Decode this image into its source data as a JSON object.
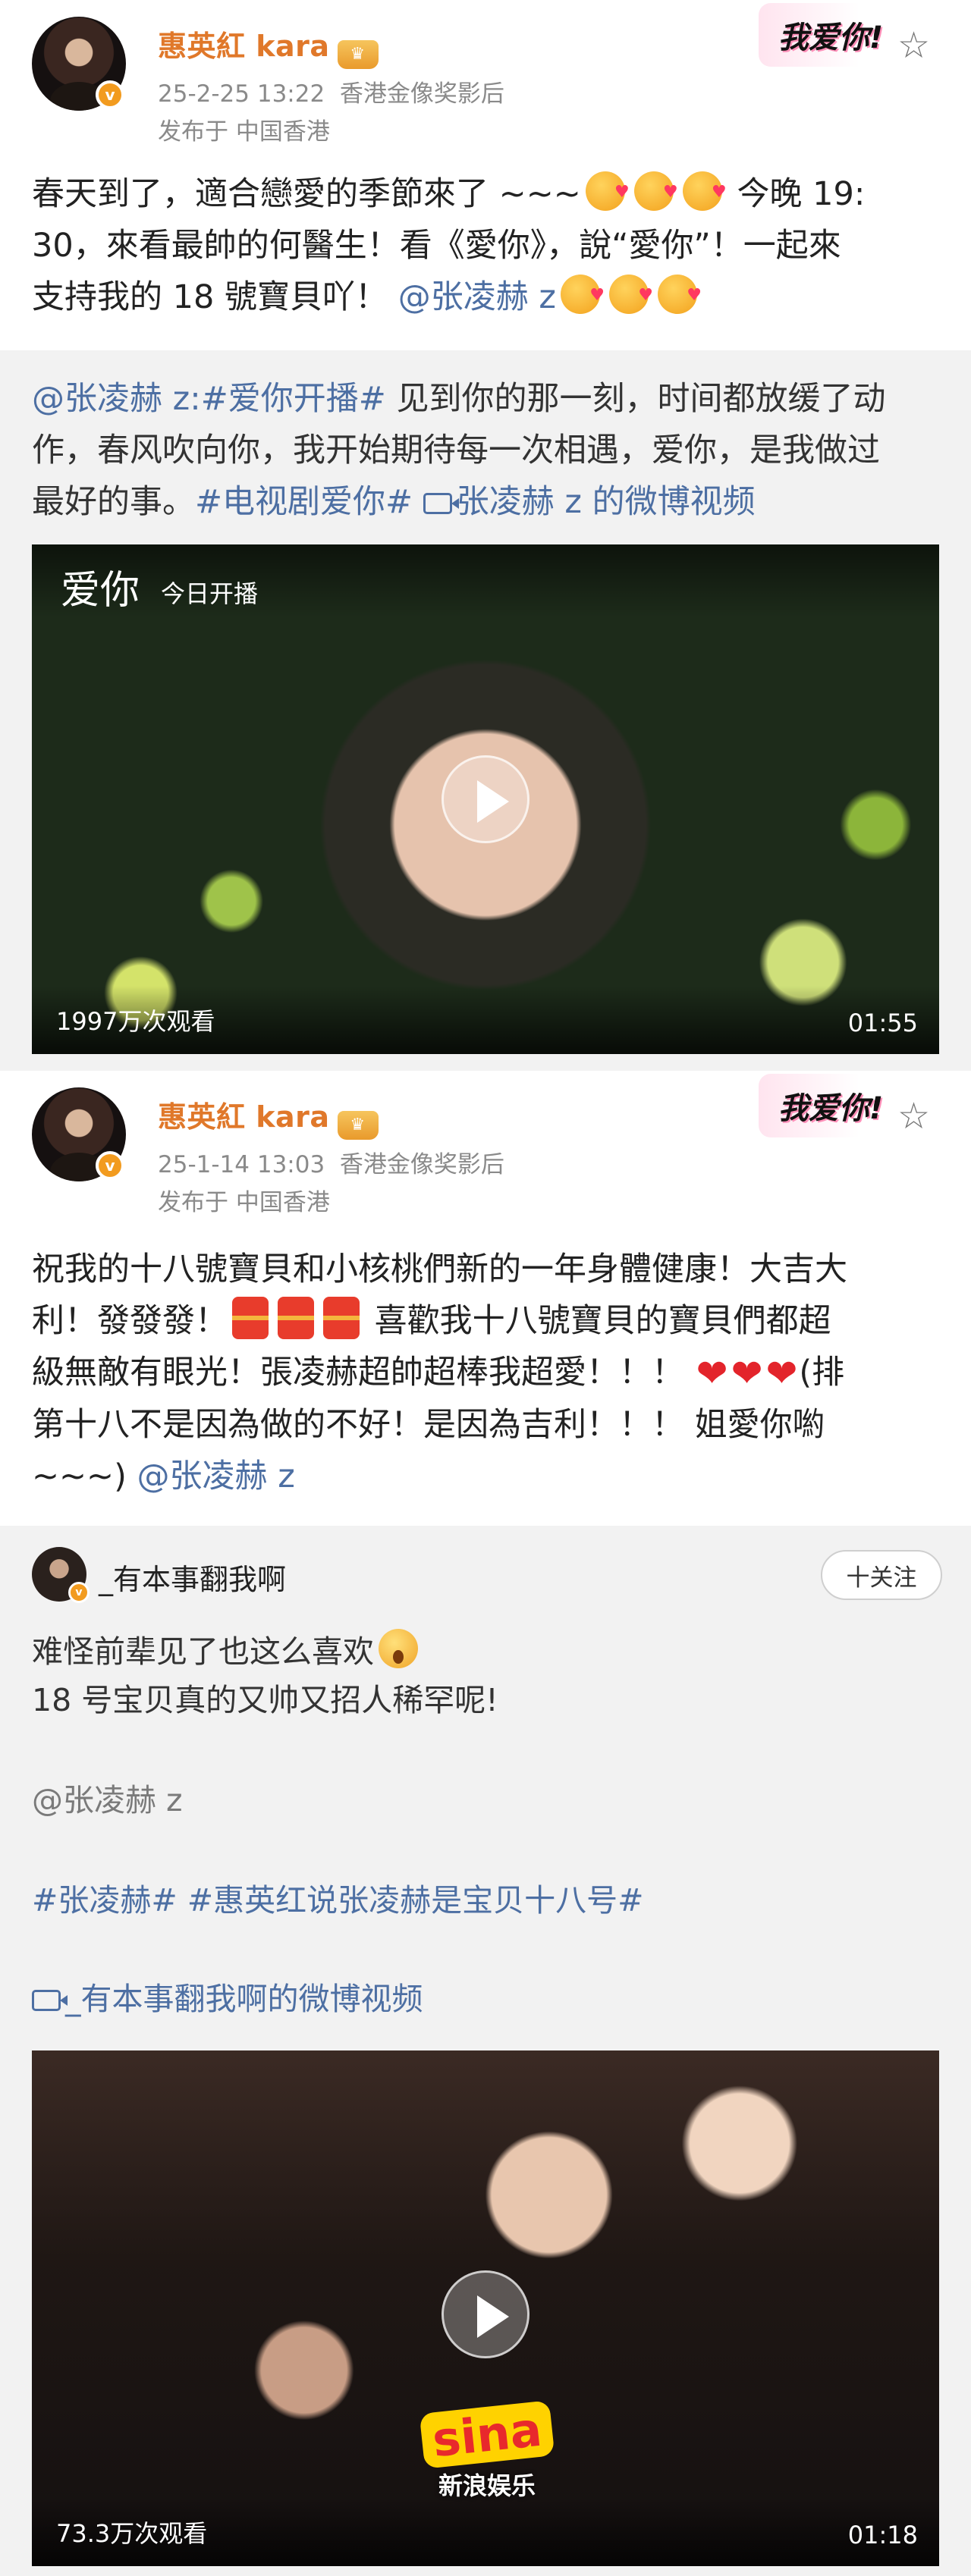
{
  "post1": {
    "author": "惠英紅 kara",
    "time": "25-2-25 13:22",
    "source": "香港金像奖影后",
    "location": "发布于 中国香港",
    "badge_art_text": "我爱你!",
    "text_line1": "春天到了，適合戀愛的季節來了 ~~~",
    "text_line1_tail": "今晚 19:",
    "text_line2": "30，來看最帥的何醫生！看《愛你》，說“愛你”！一起來",
    "text_line3": "支持我的 18 號寶貝吖！",
    "mention": "@张凌赫 z"
  },
  "repost1": {
    "line1_mention": "@张凌赫 z:",
    "line1_tag": "#爱你开播#",
    "line1_text": " 见到你的那一刻，时间都放缓了动",
    "line2": "作，春风吹向你，我开始期待每一次相遇，爱你，是我做过",
    "line3_text": "最好的事。",
    "line3_tag": "#电视剧爱你#",
    "line3_link": "张凌赫 z 的微博视频",
    "video": {
      "logo_text": "爱你",
      "top_text": "今日开播",
      "views": "1997万次观看",
      "duration": "01:55"
    }
  },
  "post2": {
    "author": "惠英紅 kara",
    "time": "25-1-14 13:03",
    "source": "香港金像奖影后",
    "location": "发布于 中国香港",
    "badge_art_text": "我爱你!",
    "line1": "祝我的十八號寶貝和小核桃們新的一年身體健康！大吉大",
    "line2_a": "利！發發發！",
    "line2_b": "喜歡我十八號寶貝的寶貝們都超",
    "line3": "級無敵有眼光！張凌赫超帥超棒我超愛！！！",
    "line3_tail": "(排",
    "line4": "第十八不是因為做的不好！是因為吉利！！！ 姐愛你喲",
    "line5_text": "~~~)",
    "mention": "@张凌赫 z"
  },
  "repost2": {
    "author": "_有本事翻我啊",
    "follow_label": "十关注",
    "line1": "难怪前辈见了也这么喜欢",
    "line2": "18 号宝贝真的又帅又招人稀罕呢!",
    "mention": "@张凌赫 z",
    "tags": "#张凌赫# #惠英红说张凌赫是宝贝十八号#",
    "video_link": "_有本事翻我啊的微博视频",
    "video": {
      "watermark": "sina",
      "watermark_sub": "新浪娱乐",
      "views": "73.3万次观看",
      "duration": "01:18"
    }
  },
  "icons": {
    "star": "star-outline-icon",
    "verified": "verified-v-icon",
    "play": "play-icon",
    "video_link": "video-camera-icon"
  },
  "colors": {
    "author_name": "#e0782a",
    "link": "#4d6fa3",
    "repost_background": "#f2f2f2",
    "verified": "#f29b1f"
  }
}
